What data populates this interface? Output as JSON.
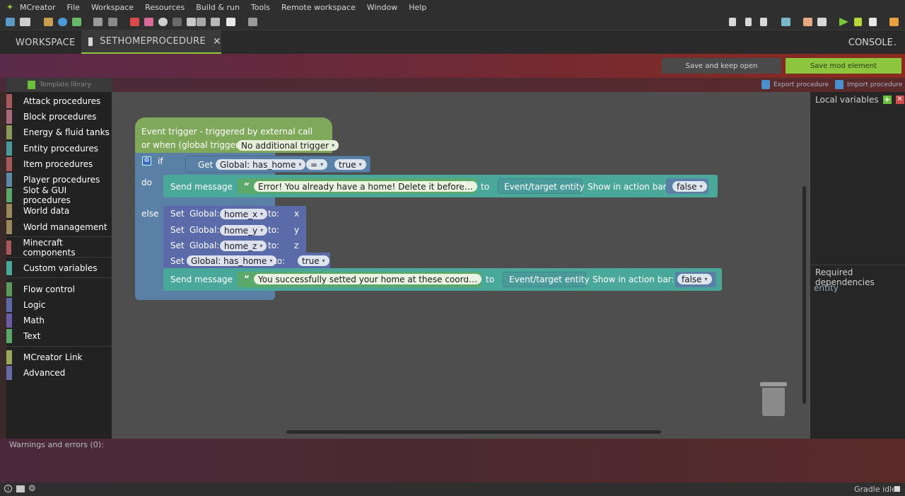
{
  "app": {
    "name": "MCreator"
  },
  "menu": [
    "MCreator",
    "File",
    "Workspace",
    "Resources",
    "Build & run",
    "Tools",
    "Remote workspace",
    "Window",
    "Help"
  ],
  "tabs": {
    "workspace": "WORKSPACE",
    "active": "SETHOMEPROCEDURE",
    "console": "CONSOLE"
  },
  "actions": {
    "save_keep_open": "Save and keep open",
    "save_mod_element": "Save mod element"
  },
  "strip": {
    "template_library": "Template library",
    "export": "Export procedure",
    "import": "Import procedure"
  },
  "categories": [
    {
      "label": "Attack procedures",
      "color": "#a85a5a"
    },
    {
      "label": "Block procedures",
      "color": "#a86a7a"
    },
    {
      "label": "Energy & fluid tanks",
      "color": "#8a9a5a"
    },
    {
      "label": "Entity procedures",
      "color": "#4a9a9a"
    },
    {
      "label": "Item procedures",
      "color": "#a85a5a"
    },
    {
      "label": "Player procedures",
      "color": "#5a8aa8"
    },
    {
      "label": "Slot & GUI procedures",
      "color": "#5aa86a"
    },
    {
      "label": "World data",
      "color": "#9a8a5a"
    },
    {
      "label": "World management",
      "color": "#9a8a5a"
    },
    {
      "label": "Minecraft components",
      "color": "#a85a5a"
    },
    {
      "label": "Custom variables",
      "color": "#4aa89a"
    },
    {
      "label": "Flow control",
      "color": "#5a9a5a"
    },
    {
      "label": "Logic",
      "color": "#5a6aa8"
    },
    {
      "label": "Math",
      "color": "#6a5aa8"
    },
    {
      "label": "Text",
      "color": "#5aa86a"
    },
    {
      "label": "MCreator Link",
      "color": "#9aa85a"
    },
    {
      "label": "Advanced",
      "color": "#6a6aa8"
    }
  ],
  "right_panel": {
    "local_vars": "Local variables",
    "required_deps": "Required dependencies",
    "dep": "entity"
  },
  "blocks": {
    "event_line1": "Event trigger - triggered by external call",
    "event_line2": "or when (global trigger):",
    "trigger_value": "No additional trigger",
    "if": "if",
    "do": "do",
    "else": "else",
    "get": "Get",
    "global_has_home": "Global: has_home",
    "eq": "=",
    "true": "true",
    "send_message": "Send message",
    "msg1": "Error! You already have a home! Delete it before…",
    "msg2": "You successfully setted your home at these coord…",
    "to": "to",
    "event_target": "Event/target entity",
    "show_action_bar": "Show in action bar:",
    "false": "false",
    "set": "Set",
    "global": "Global:",
    "to_colon": "to:",
    "home_x": "home_x",
    "home_y": "home_y",
    "home_z": "home_z",
    "x": "x",
    "y": "y",
    "z": "z",
    "global_has_home_plain": "Global: has_home",
    "open_quote": "“",
    "close_quote": "”"
  },
  "bottom": {
    "warnings": "Warnings and errors (0):",
    "gradle": "Gradle idle"
  }
}
